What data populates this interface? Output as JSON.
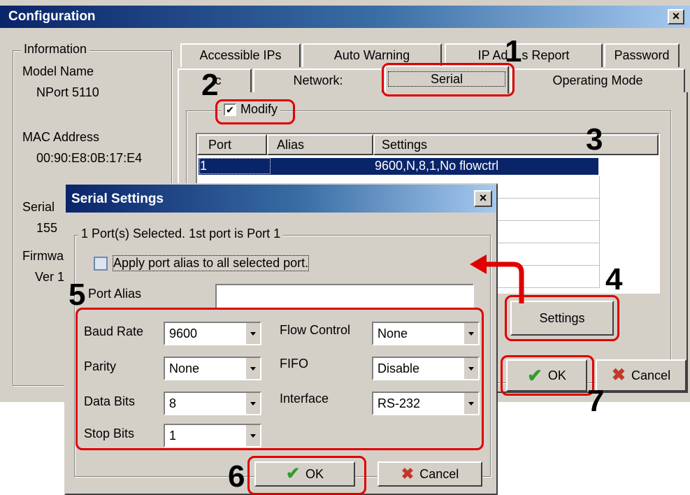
{
  "config": {
    "title": "Configuration",
    "close_glyph": "×",
    "info": {
      "legend": "Information",
      "model_label": "Model Name",
      "model_value": "NPort 5110",
      "mac_label": "MAC Address",
      "mac_value": "00:90:E8:0B:17:E4",
      "serial_label": "Serial",
      "serial_value": "155",
      "firmware_label": "Firmwa",
      "firmware_value": "Ver 1"
    },
    "tabs_top": [
      "Accessible IPs",
      "Auto Warning",
      "IP Ad    s Report",
      "Password"
    ],
    "tabs_bottom": [
      "  c",
      "Network:",
      "Serial",
      "Operating Mode"
    ],
    "modify_label": "Modify",
    "modify_checked": true,
    "table": {
      "headers": [
        "Port",
        "Alias",
        "Settings"
      ],
      "rows": [
        {
          "port": "1",
          "alias": "",
          "settings": "9600,N,8,1,No flowctrl"
        }
      ]
    },
    "settings_button": "Settings",
    "ok_button": "OK",
    "cancel_button": "Cancel"
  },
  "serial_dialog": {
    "title": "Serial Settings",
    "close_glyph": "×",
    "group_legend": "1 Port(s) Selected. 1st port is Port 1",
    "apply_alias_label": "Apply port alias to all selected port.",
    "apply_alias_checked": false,
    "port_alias_label": "Port Alias",
    "port_alias_value": "",
    "fields": {
      "baud_rate": {
        "label": "Baud Rate",
        "value": "9600"
      },
      "parity": {
        "label": "Parity",
        "value": "None"
      },
      "data_bits": {
        "label": "Data Bits",
        "value": "8"
      },
      "stop_bits": {
        "label": "Stop Bits",
        "value": "1"
      },
      "flow_control": {
        "label": "Flow Control",
        "value": "None"
      },
      "fifo": {
        "label": "FIFO",
        "value": "Disable"
      },
      "interface": {
        "label": "Interface",
        "value": "RS-232"
      }
    },
    "ok_button": "OK",
    "cancel_button": "Cancel"
  },
  "annotations": {
    "step1": "1",
    "step2": "2",
    "step3": "3",
    "step4": "4",
    "step5": "5",
    "step6": "6",
    "step7": "7",
    "callout_color": "#e00000"
  },
  "colors": {
    "window_bg": "#d4d0c8",
    "title_start": "#0a246a",
    "title_end": "#a6caf0",
    "selection": "#0a246a",
    "ok_check": "#2e9e2e",
    "cancel_x": "#c0392b"
  },
  "icons": {
    "ok": "check-icon",
    "cancel": "x-icon",
    "close": "close-icon",
    "arrow": "curved-arrow"
  }
}
